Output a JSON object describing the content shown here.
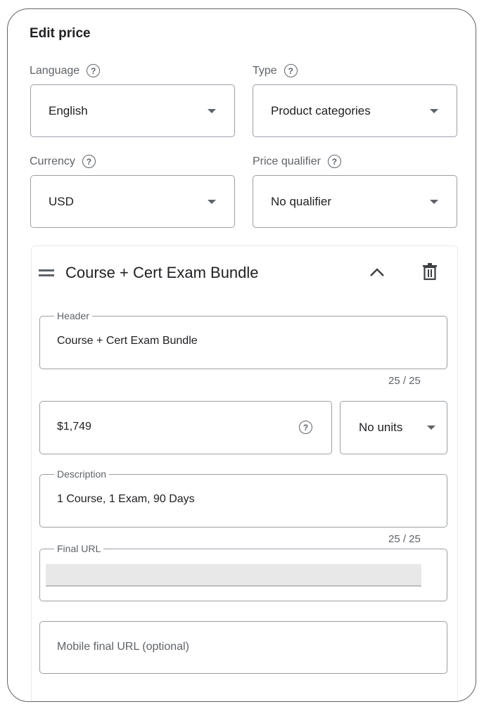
{
  "dialog": {
    "title": "Edit price",
    "help_glyph": "?",
    "language": {
      "label": "Language",
      "value": "English"
    },
    "type": {
      "label": "Type",
      "value": "Product categories"
    },
    "currency": {
      "label": "Currency",
      "value": "USD"
    },
    "price_qualifier": {
      "label": "Price qualifier",
      "value": "No qualifier"
    }
  },
  "item": {
    "title": "Course + Cert Exam Bundle",
    "header": {
      "label": "Header",
      "value": "Course + Cert Exam Bundle",
      "counter": "25 / 25"
    },
    "price": {
      "value": "$1,749",
      "unit": "No units"
    },
    "description": {
      "label": "Description",
      "value": "1 Course, 1 Exam, 90 Days",
      "counter": "25 / 25"
    },
    "final_url": {
      "label": "Final URL"
    },
    "mobile_url": {
      "placeholder": "Mobile final URL (optional)"
    }
  },
  "icons": [
    "drag-handle-icon",
    "chevron-up-icon",
    "trash-icon",
    "help-icon",
    "dropdown-arrow-icon"
  ],
  "colors": {
    "text": "#202124",
    "secondary": "#5f6368",
    "border": "#9aa0a6"
  }
}
